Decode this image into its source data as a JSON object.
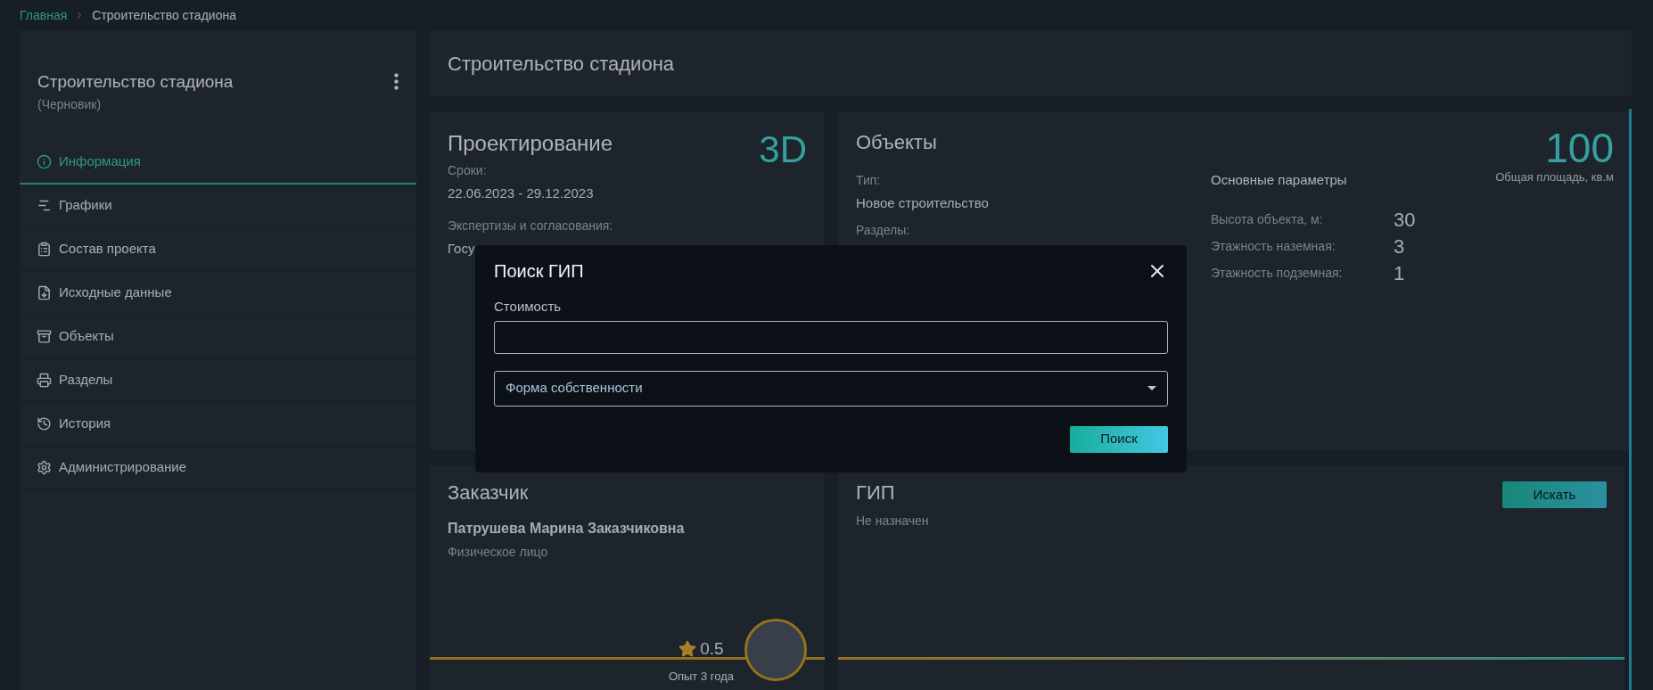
{
  "breadcrumb": [
    {
      "label": "Главная",
      "kind": "link"
    },
    {
      "label": "Строительство стадиона",
      "kind": "current"
    }
  ],
  "sidebar": {
    "title": "Строительство стадиона",
    "status": "(Черновик)",
    "items": [
      {
        "label": "Информация",
        "selected": true
      },
      {
        "label": "Графики",
        "selected": false
      },
      {
        "label": "Состав проекта",
        "selected": false
      },
      {
        "label": "Исходные данные",
        "selected": false
      },
      {
        "label": "Объекты",
        "selected": false
      },
      {
        "label": "Разделы",
        "selected": false
      },
      {
        "label": "История",
        "selected": false
      },
      {
        "label": "Администрирование",
        "selected": false
      }
    ]
  },
  "header": {
    "title": "Строительство стадиона"
  },
  "design": {
    "title": "Проектирование",
    "badge": "3D",
    "fields": [
      {
        "label": "Сроки:",
        "value": "22.06.2023 - 29.12.2023"
      },
      {
        "label": "Экспертизы и согласования:",
        "value": "Госу"
      }
    ]
  },
  "objects": {
    "title": "Объекты",
    "fields": [
      {
        "label": "Тип:",
        "value": "Новое строительство"
      },
      {
        "label": "Разделы:"
      }
    ],
    "params_title": "Основные параметры",
    "params": [
      {
        "label": "Высота объекта, м:",
        "value": "30"
      },
      {
        "label": "Этажность наземная:",
        "value": "3"
      },
      {
        "label": "Этажность подземная:",
        "value": "1"
      }
    ],
    "total": {
      "value": "100",
      "label": "Общая площадь, кв.м"
    }
  },
  "customer": {
    "title": "Заказчик",
    "name": "Патрушева Марина Заказчиковна",
    "type": "Физическое лицо",
    "rating": "0.5",
    "experience": "Опыт 3 года"
  },
  "gip": {
    "title": "ГИП",
    "status": "Не назначен",
    "button": "Искать"
  },
  "modal": {
    "title": "Поиск ГИП",
    "cost_label": "Стоимость",
    "select_placeholder": "Форма собственности",
    "button": "Поиск"
  }
}
